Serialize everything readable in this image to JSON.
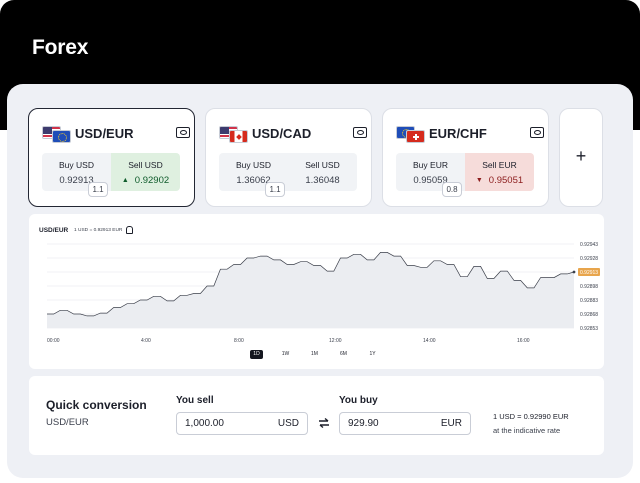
{
  "app": {
    "title": "Forex"
  },
  "cards": [
    {
      "pair": "USD/EUR",
      "base_flag": "us",
      "quote_flag": "eu",
      "selected": true,
      "buy_label": "Buy USD",
      "buy_value": "0.92913",
      "sell_label": "Sell USD",
      "sell_value": "0.92902",
      "trend": "up",
      "spread": "1.1"
    },
    {
      "pair": "USD/CAD",
      "base_flag": "us",
      "quote_flag": "ca",
      "selected": false,
      "buy_label": "Buy USD",
      "buy_value": "1.36062",
      "sell_label": "Sell USD",
      "sell_value": "1.36048",
      "trend": "none",
      "spread": "1.1"
    },
    {
      "pair": "EUR/CHF",
      "base_flag": "eu",
      "quote_flag": "ch",
      "selected": false,
      "buy_label": "Buy EUR",
      "buy_value": "0.95059",
      "sell_label": "Sell EUR",
      "sell_value": "0.95051",
      "trend": "down",
      "spread": "0.8"
    }
  ],
  "icons": {
    "bank": "bank-note-icon",
    "add": "plus-icon",
    "alert": "bell-icon",
    "swap": "swap-arrows-icon"
  },
  "add_card": {
    "label": "+"
  },
  "chart": {
    "pair": "USD/EUR",
    "rate_note": "1 USD = 0.92913 EUR",
    "ranges": [
      "1D",
      "1W",
      "1M",
      "6M",
      "1Y"
    ],
    "active_range": "1D"
  },
  "chart_data": {
    "type": "area",
    "x_ticks": [
      "00:00",
      "4:00",
      "8:00",
      "12:00",
      "14:00",
      "16:00"
    ],
    "y_ticks": [
      0.92943,
      0.92928,
      0.92913,
      0.92898,
      0.92883,
      0.92868,
      0.92853
    ],
    "ylim": [
      0.92853,
      0.92943
    ],
    "current_value": 0.92913,
    "current_label": "0.92913",
    "grid": "horizontal",
    "series": [
      {
        "values": [
          0.92868,
          0.92868,
          0.92872,
          0.92872,
          0.92868,
          0.92868,
          0.92866,
          0.92866,
          0.92869,
          0.92869,
          0.92875,
          0.92875,
          0.92879,
          0.92879,
          0.92883,
          0.92883,
          0.92887,
          0.92887,
          0.92882,
          0.92882,
          0.92888,
          0.92888,
          0.9289,
          0.9289,
          0.92898,
          0.92898,
          0.92916,
          0.92916,
          0.92921,
          0.92921,
          0.92928,
          0.92928,
          0.9293,
          0.9293,
          0.92926,
          0.92926,
          0.92921,
          0.92921,
          0.92924,
          0.92924,
          0.9292,
          0.9292,
          0.92914,
          0.92914,
          0.92928,
          0.92928,
          0.92932,
          0.92932,
          0.92926,
          0.92926,
          0.92934,
          0.92934,
          0.9293,
          0.9293,
          0.9292,
          0.9292,
          0.92918,
          0.92918,
          0.92925,
          0.92925,
          0.92921,
          0.92921,
          0.92908,
          0.92908,
          0.92919,
          0.92919,
          0.92906,
          0.92906,
          0.92914,
          0.92914,
          0.92904,
          0.92904,
          0.92896,
          0.92896,
          0.92907,
          0.92907,
          0.92907,
          0.92911,
          0.92911,
          0.92913
        ]
      }
    ]
  },
  "conversion": {
    "title": "Quick conversion",
    "pair": "USD/EUR",
    "sell_label": "You sell",
    "sell_amount": "1,000.00",
    "sell_currency": "USD",
    "buy_label": "You buy",
    "buy_amount": "929.90",
    "buy_currency": "EUR",
    "rate": "1 USD = 0.92990 EUR",
    "rate_note": "at the indicative rate"
  },
  "colors": {
    "header": "#000000",
    "panel": "#eef0f5",
    "up_bg": "#dff0e0",
    "down_bg": "#f6dcda",
    "current_price_tag": "#e8a54c",
    "range_active": "#14161f"
  }
}
